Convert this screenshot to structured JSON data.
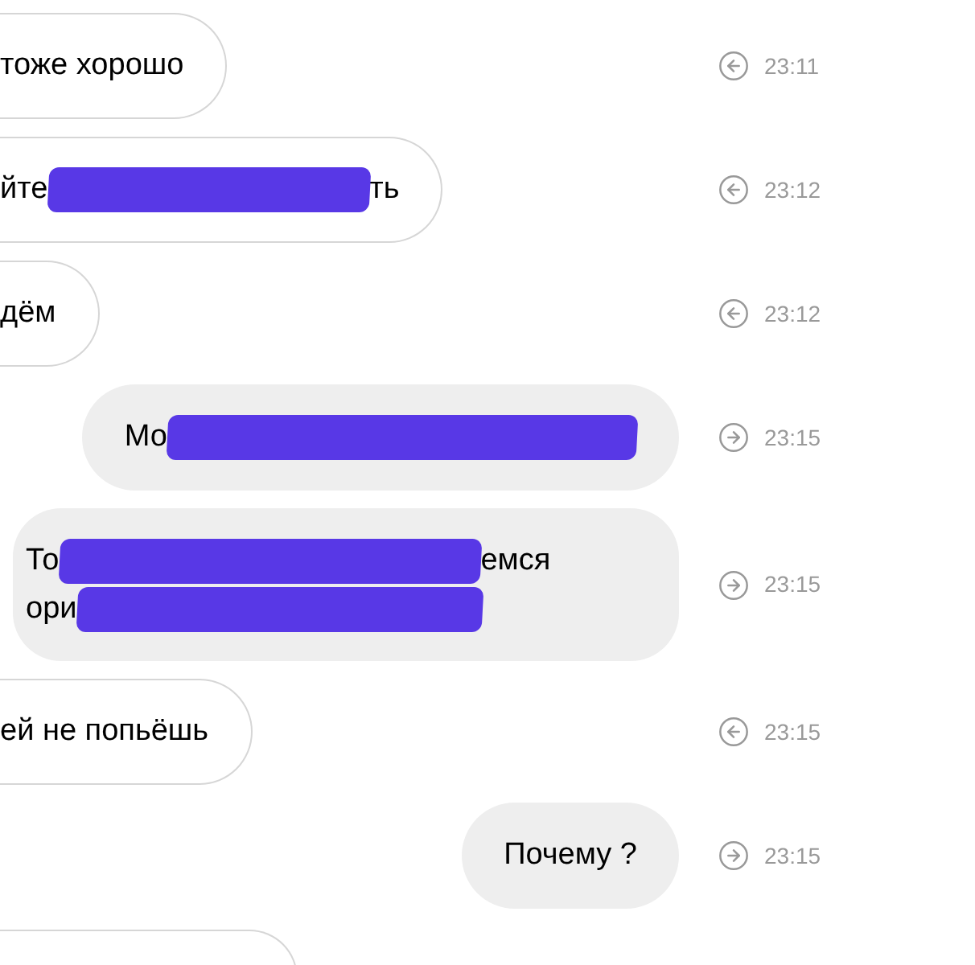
{
  "messages": [
    {
      "kind": "incoming",
      "lines": [
        [
          {
            "kind": "text",
            "text": "тоже хорошо"
          }
        ]
      ],
      "time": "23:11"
    },
    {
      "kind": "incoming",
      "lines": [
        [
          {
            "kind": "text",
            "text": "йте"
          },
          {
            "kind": "redacted"
          },
          {
            "kind": "text",
            "text": "ть"
          }
        ]
      ],
      "time": "23:12"
    },
    {
      "kind": "incoming",
      "lines": [
        [
          {
            "kind": "text",
            "text": "дём"
          }
        ]
      ],
      "time": "23:12"
    },
    {
      "kind": "outgoing",
      "lines": [
        [
          {
            "kind": "text",
            "text": "Мо"
          },
          {
            "kind": "redacted"
          }
        ]
      ],
      "time": "23:15"
    },
    {
      "kind": "outgoing",
      "lines": [
        [
          {
            "kind": "text",
            "text": "То"
          },
          {
            "kind": "redacted"
          },
          {
            "kind": "text",
            "text": "емся"
          }
        ],
        [
          {
            "kind": "text",
            "text": "ори"
          },
          {
            "kind": "redacted"
          }
        ]
      ],
      "time": "23:15"
    },
    {
      "kind": "incoming",
      "lines": [
        [
          {
            "kind": "text",
            "text": "ей не попьёшь"
          }
        ]
      ],
      "time": "23:15"
    },
    {
      "kind": "outgoing",
      "lines": [
        [
          {
            "kind": "text",
            "text": "Почему ?"
          }
        ]
      ],
      "time": "23:15"
    },
    {
      "kind": "partial"
    }
  ]
}
